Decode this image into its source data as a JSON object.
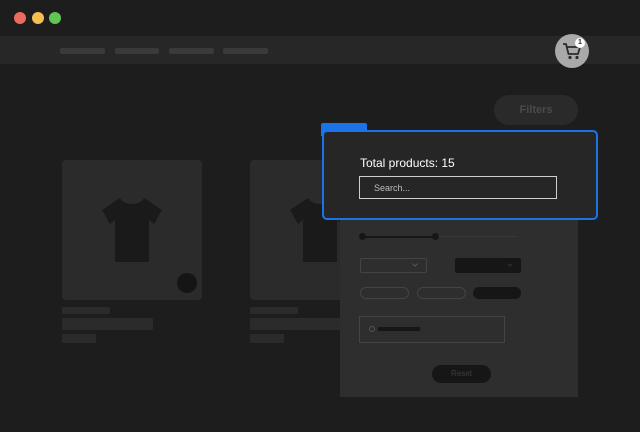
{
  "window": {
    "controls": [
      {
        "name": "close",
        "color": "#ed6a5e"
      },
      {
        "name": "minimize",
        "color": "#f5bf4f"
      },
      {
        "name": "maximize",
        "color": "#61c554"
      }
    ]
  },
  "header": {
    "cart_icon": "cart-icon",
    "cart_count": "1"
  },
  "toolbar": {
    "filters_label": "Filters"
  },
  "filter_overlay": {
    "total_label": "Total products: 15",
    "search_placeholder": "Search..."
  },
  "filter_panel": {
    "reset_label": "Reset"
  },
  "colors": {
    "accent": "#1a73e8",
    "background": "#1d1d1d"
  }
}
